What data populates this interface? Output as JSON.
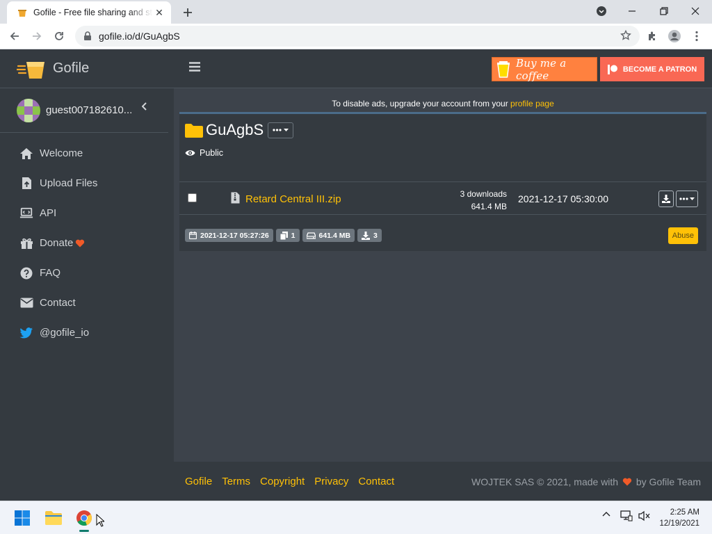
{
  "browser": {
    "tab_title": "Gofile - Free file sharing and storage",
    "url": "gofile.io/d/GuAgbS"
  },
  "sidebar": {
    "brand": "Gofile",
    "username": "guest007182610...",
    "items": [
      {
        "label": "Welcome",
        "icon": "home-icon"
      },
      {
        "label": "Upload Files",
        "icon": "file-upload-icon"
      },
      {
        "label": "API",
        "icon": "laptop-code-icon"
      },
      {
        "label": "Donate",
        "icon": "gift-icon"
      },
      {
        "label": "FAQ",
        "icon": "question-circle-icon"
      },
      {
        "label": "Contact",
        "icon": "envelope-icon"
      },
      {
        "label": "@gofile_io",
        "icon": "twitter-icon"
      }
    ]
  },
  "topbar": {
    "coffee_label": "Buy me a coffee",
    "patron_label": "BECOME A PATRON"
  },
  "main": {
    "ad_note_prefix": "To disable ads, upgrade your account from your ",
    "ad_note_link": "profile page",
    "folder_name": "GuAgbS",
    "visibility": "Public",
    "file": {
      "name": "Retard Central III.zip",
      "downloads": "3 downloads",
      "size": "641.4 MB",
      "date": "2021-12-17 05:30:00"
    },
    "summary": {
      "created": "2021-12-17 05:27:26",
      "file_count": "1",
      "total_size": "641.4 MB",
      "downloads": "3"
    },
    "abuse_label": "Abuse"
  },
  "footer": {
    "links": [
      "Gofile",
      "Terms",
      "Copyright",
      "Privacy",
      "Contact"
    ],
    "copyright_prefix": "WOJTEK SAS © 2021, made with",
    "copyright_suffix": "by Gofile Team"
  },
  "taskbar": {
    "time": "2:25 AM",
    "date": "12/19/2021"
  },
  "colors": {
    "accent": "#ffc107",
    "sidebar_bg": "#343a40",
    "content_bg": "#3d434b",
    "coffee": "#ff813f",
    "patron": "#f96854"
  }
}
